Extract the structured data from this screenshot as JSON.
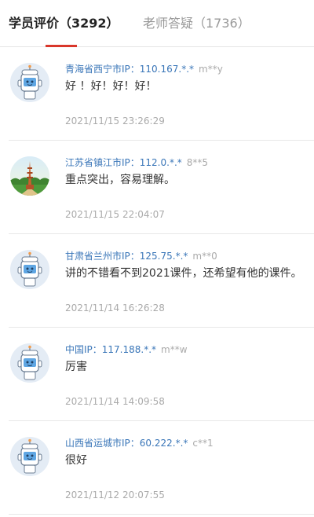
{
  "tabs": {
    "active_label": "学员评价（3292）",
    "inactive_label": "老师答疑（1736）"
  },
  "colors": {
    "accent": "#d9372b",
    "link": "#3a76b8",
    "muted": "#aaaaaa"
  },
  "reviews": [
    {
      "avatar_icon": "robot-avatar-icon",
      "location": "青海省西宁市IP：110.167.*.*",
      "user": "m**y",
      "text": "好 ！好！好！好！",
      "time": "2021/11/15 23:26:29"
    },
    {
      "avatar_icon": "tower-landscape-avatar-icon",
      "location": "江苏省镇江市IP：112.0.*.*",
      "user": "8**5",
      "text": "重点突出，容易理解。",
      "time": "2021/11/15 22:04:07"
    },
    {
      "avatar_icon": "robot-avatar-icon",
      "location": "甘肃省兰州市IP：125.75.*.*",
      "user": "m**0",
      "text": "讲的不错看不到2021课件，还希望有他的课件。",
      "time": "2021/11/14 16:26:28"
    },
    {
      "avatar_icon": "robot-avatar-icon",
      "location": "中国IP：117.188.*.*",
      "user": "m**w",
      "text": "厉害",
      "time": "2021/11/14 14:09:58"
    },
    {
      "avatar_icon": "robot-avatar-icon",
      "location": "山西省运城市IP：60.222.*.*",
      "user": "c**1",
      "text": "很好",
      "time": "2021/11/12 20:07:55"
    }
  ]
}
